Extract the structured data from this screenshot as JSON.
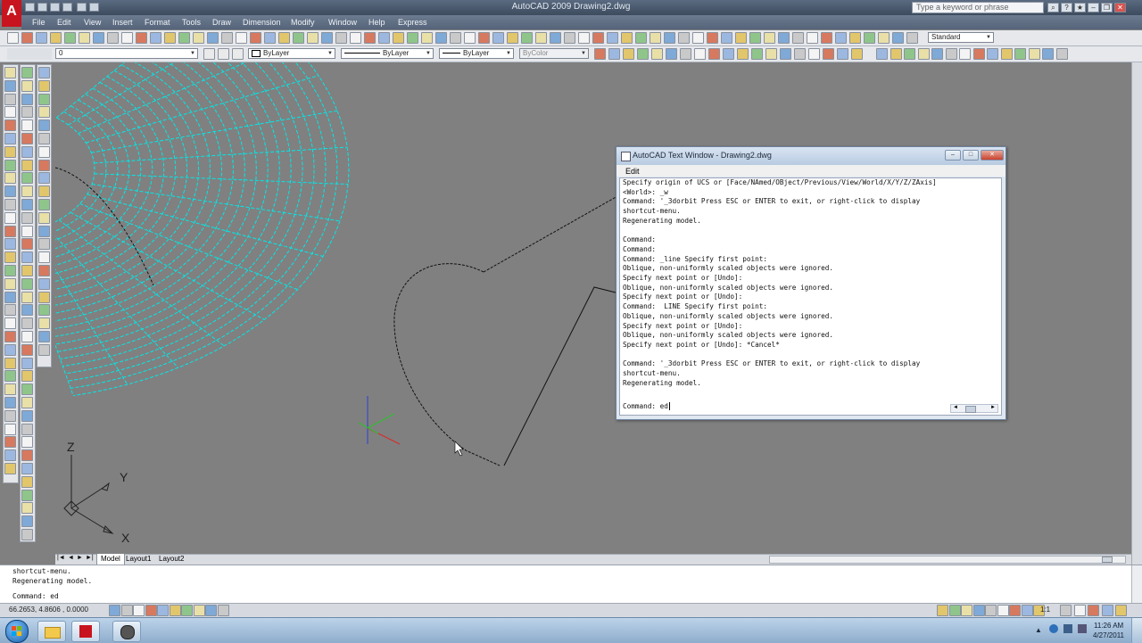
{
  "window": {
    "title": "AutoCAD 2009  Drawing2.dwg",
    "app_logo": "A"
  },
  "search": {
    "placeholder": "Type a keyword or phrase"
  },
  "menu": [
    "File",
    "Edit",
    "View",
    "Insert",
    "Format",
    "Tools",
    "Draw",
    "Dimension",
    "Modify",
    "Window",
    "Help",
    "Express"
  ],
  "toolbar": {
    "layer_value": "0",
    "color_value": "ByLayer",
    "linetype_value": "ByLayer",
    "lineweight_value": "ByLayer",
    "plotstyle_value": "ByColor",
    "textstyle_value": "Standard"
  },
  "ucs": {
    "z": "Z",
    "y": "Y",
    "x": "X"
  },
  "text_window": {
    "title": "AutoCAD Text Window - Drawing2.dwg",
    "menu_edit": "Edit",
    "lines": [
      "Specify origin of UCS or [Face/NAmed/OBject/Previous/View/World/X/Y/Z/ZAxis]",
      "<World>: _w",
      "Command: '_3dorbit Press ESC or ENTER to exit, or right-click to display",
      "shortcut-menu.",
      "Regenerating model.",
      "",
      "Command:",
      "Command:",
      "Command: _line Specify first point:",
      "Oblique, non-uniformly scaled objects were ignored.",
      "Specify next point or [Undo]:",
      "Oblique, non-uniformly scaled objects were ignored.",
      "Specify next point or [Undo]:",
      "Command:  LINE Specify first point:",
      "Oblique, non-uniformly scaled objects were ignored.",
      "Specify next point or [Undo]:",
      "Oblique, non-uniformly scaled objects were ignored.",
      "Specify next point or [Undo]: *Cancel*",
      "",
      "Command: '_3dorbit Press ESC or ENTER to exit, or right-click to display",
      "shortcut-menu.",
      "Regenerating model."
    ],
    "prompt": "Command: ed"
  },
  "layout_tabs": [
    "Model",
    "Layout1",
    "Layout2"
  ],
  "command_line": [
    "shortcut-menu.",
    "Regenerating model.",
    "Command: ed"
  ],
  "status": {
    "coordinates": "66.2653, 4.8606 , 0.0000",
    "annotation_scale": "1:1"
  },
  "clock": {
    "time": "11:26 AM",
    "date": "4/27/2011"
  },
  "colors": {
    "background": "#808080",
    "surface": "#00e5e5",
    "accent": "#c8141e"
  }
}
